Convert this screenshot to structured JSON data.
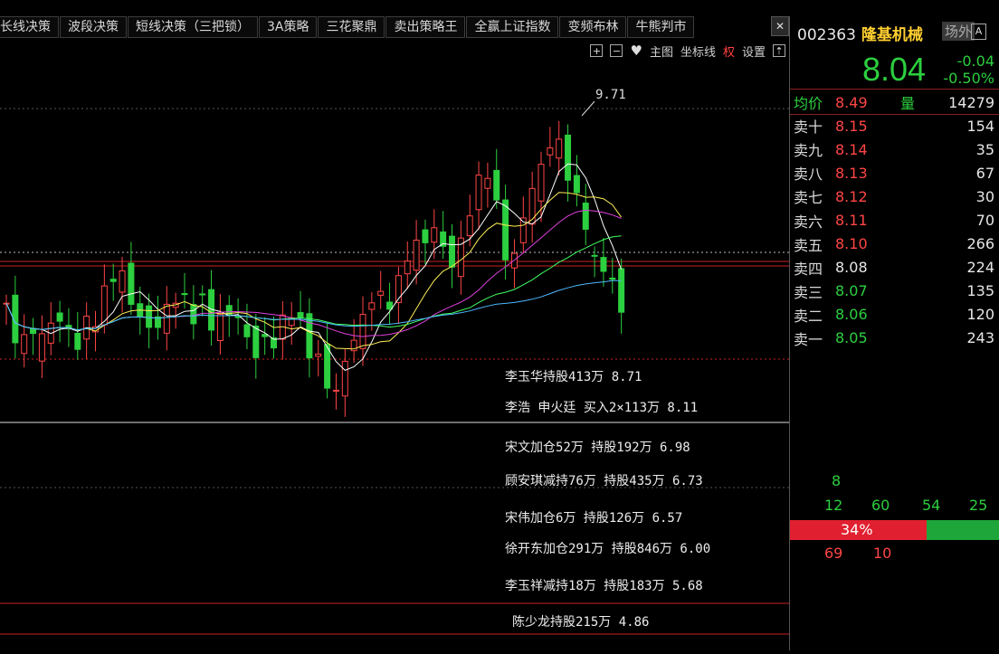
{
  "tabs": [
    "长线决策",
    "波段决策",
    "短线决策（三把锁）",
    "3A策略",
    "三花聚鼎",
    "卖出策略王",
    "全赢上证指数",
    "变频布林",
    "牛熊判市"
  ],
  "toolbar": {
    "main_chart": "主图",
    "coord": "坐标线",
    "quan": "权",
    "settings": "设置"
  },
  "chart": {
    "high_label": "9.71",
    "annotations": [
      "李玉华持股413万 8.71",
      "李浩 申火廷 买入2×113万 8.11",
      "宋文加仓52万 持股192万 6.98",
      "顾安琪减持76万 持股435万 6.73",
      "宋伟加仓6万 持股126万 6.57",
      "徐开东加仓291万 持股846万 6.00",
      "李玉祥减持18万 持股183万 5.68",
      "陈少龙持股215万 4.86"
    ]
  },
  "stock": {
    "code": "002363",
    "name": "隆基机械",
    "venue": "场外",
    "a_icon": "A",
    "price": "8.04",
    "change": "-0.04",
    "change_pct": "-0.50%"
  },
  "avg_row": {
    "label": "均价",
    "price": "8.49",
    "vol_label": "量",
    "vol": "14279"
  },
  "asks": [
    {
      "label": "卖十",
      "price": "8.15",
      "vol": "154",
      "dir": "up"
    },
    {
      "label": "卖九",
      "price": "8.14",
      "vol": "35",
      "dir": "up"
    },
    {
      "label": "卖八",
      "price": "8.13",
      "vol": "67",
      "dir": "up"
    },
    {
      "label": "卖七",
      "price": "8.12",
      "vol": "30",
      "dir": "up"
    },
    {
      "label": "卖六",
      "price": "8.11",
      "vol": "70",
      "dir": "up"
    },
    {
      "label": "卖五",
      "price": "8.10",
      "vol": "266",
      "dir": "up"
    },
    {
      "label": "卖四",
      "price": "8.08",
      "vol": "224",
      "dir": "flat"
    },
    {
      "label": "卖三",
      "price": "8.07",
      "vol": "135",
      "dir": "dn"
    },
    {
      "label": "卖二",
      "price": "8.06",
      "vol": "120",
      "dir": "dn"
    },
    {
      "label": "卖一",
      "price": "8.05",
      "vol": "243",
      "dir": "dn"
    }
  ],
  "indicators": {
    "a": "8",
    "b": "12",
    "c": "60",
    "d": "54",
    "e": "25",
    "ratio": "34%",
    "ratio_value": 0.34,
    "f": "69",
    "g": "10"
  },
  "colors": {
    "up": "#ff4545",
    "down": "#2ccf3f",
    "ma5": "#ffffff",
    "ma10": "#ffee55",
    "ma20": "#e040e0",
    "ma30": "#40ff60",
    "ma60": "#4db8ff"
  }
}
